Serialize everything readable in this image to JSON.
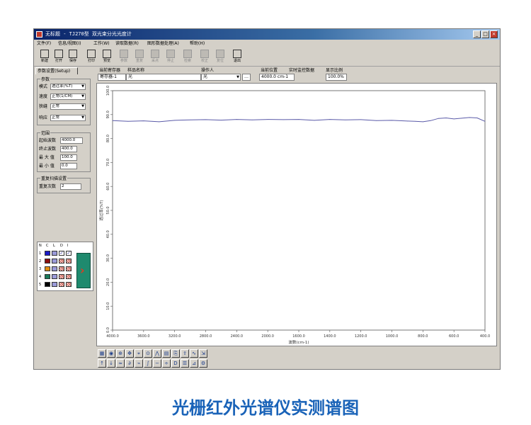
{
  "window": {
    "title": "无标题 - TJ270型 双光束分光光度计",
    "buttons": [
      "_",
      "□",
      "×"
    ]
  },
  "menu": [
    "文件(F)",
    "信息/视图(I)",
    "工作(W)",
    "读取数据(R)",
    "图形数据处理(A)",
    "帮助(H)"
  ],
  "toolbar": [
    {
      "label": "新建",
      "icon": "new-file-icon",
      "enabled": true
    },
    {
      "label": "打开",
      "icon": "open-folder-icon",
      "enabled": true
    },
    {
      "label": "保存",
      "icon": "save-disk-icon",
      "enabled": true
    },
    {
      "label": "打印",
      "icon": "print-icon",
      "enabled": true
    },
    {
      "label": "预览",
      "icon": "preview-icon",
      "enabled": true
    },
    {
      "label": "参数",
      "icon": "params-icon",
      "enabled": false
    },
    {
      "label": "重复",
      "icon": "repeat-icon",
      "enabled": false
    },
    {
      "label": "采点",
      "icon": "sample-icon",
      "enabled": false
    },
    {
      "label": "停止",
      "icon": "stop-icon",
      "enabled": false
    },
    {
      "label": "检索",
      "icon": "search-icon",
      "enabled": false
    },
    {
      "label": "校正",
      "icon": "calibrate-icon",
      "enabled": false
    },
    {
      "label": "复位",
      "icon": "reset-icon",
      "enabled": false
    },
    {
      "label": "退出",
      "icon": "exit-icon",
      "enabled": true
    }
  ],
  "left_panel": {
    "tab": "参数设置(Setup)",
    "params_group": "参数",
    "params": [
      {
        "label": "模式",
        "value": "透过率(%T)"
      },
      {
        "label": "速度",
        "value": "正常(1/CM)"
      },
      {
        "label": "狭缝",
        "value": "正常"
      },
      {
        "label": "响应",
        "value": "正常"
      }
    ],
    "range_group": "范围",
    "range": [
      {
        "label": "起始波数",
        "value": "4000.0"
      },
      {
        "label": "终止波数",
        "value": "400.0"
      },
      {
        "label": "最 大 值",
        "value": "100.0"
      },
      {
        "label": "最 小 值",
        "value": "0.0"
      }
    ],
    "repeat_group": "重复扫描设置",
    "repeat": [
      {
        "label": "重复次数",
        "value": "2"
      }
    ],
    "curve_header": [
      "N",
      "C",
      "L",
      "D",
      "I"
    ],
    "curves": [
      {
        "n": "1",
        "color": "#1a1ac8",
        "d": true,
        "i": true
      },
      {
        "n": "2",
        "color": "#8b1010",
        "d": false,
        "i": false
      },
      {
        "n": "3",
        "color": "#e08c10",
        "d": false,
        "i": false
      },
      {
        "n": "4",
        "color": "#1a7a5a",
        "d": false,
        "i": false
      },
      {
        "n": "5",
        "color": "#000000",
        "d": false,
        "i": false
      }
    ]
  },
  "info_bar": {
    "labels": [
      "当前寄存器",
      "样品名称",
      "操作人",
      "当前位置",
      "实时监控数据",
      "显示比例"
    ],
    "register": "寄存器-1",
    "sample": "光",
    "operator": "光",
    "position": "4000.0 cm-1",
    "scale": "100.0%"
  },
  "chart_data": {
    "type": "line",
    "xlabel": "波数(cm-1)",
    "ylabel": "透过率(%T)",
    "xlim": [
      4000,
      400
    ],
    "ylim": [
      0,
      100
    ],
    "x_ticks": [
      "4000.0",
      "3600.0",
      "3200.0",
      "2800.0",
      "2400.0",
      "2000.0",
      "1600.0",
      "1400.0",
      "1200.0",
      "1000.0",
      "800.0",
      "600.0",
      "400.0"
    ],
    "x_tick_values": [
      4000,
      3600,
      3200,
      2800,
      2400,
      2000,
      1600,
      1400,
      1200,
      1000,
      800,
      600,
      400
    ],
    "y_ticks": [
      "0.0",
      "10.0",
      "20.0",
      "30.0",
      "40.0",
      "50.0",
      "60.0",
      "70.0",
      "80.0",
      "90.0",
      "100.0"
    ],
    "y_tick_values": [
      0,
      10,
      20,
      30,
      40,
      50,
      60,
      70,
      80,
      90,
      100
    ],
    "series": [
      {
        "color": "#5a5aa8",
        "x": [
          4000,
          3800,
          3600,
          3400,
          3200,
          3000,
          2800,
          2600,
          2400,
          2200,
          2000,
          1800,
          1600,
          1500,
          1400,
          1300,
          1200,
          1100,
          1000,
          900,
          850,
          800,
          750,
          700,
          650,
          600,
          550,
          500,
          450,
          400
        ],
        "y": [
          87.5,
          87.2,
          87.4,
          87.0,
          87.6,
          87.8,
          87.9,
          87.7,
          88.0,
          87.8,
          88.0,
          87.9,
          88.0,
          87.6,
          88.0,
          87.8,
          87.9,
          87.5,
          87.6,
          87.3,
          87.2,
          87.0,
          87.5,
          88.4,
          88.6,
          88.2,
          88.5,
          88.8,
          88.6,
          87.2
        ]
      }
    ]
  },
  "bottom_tools": [
    "grid-icon",
    "zoom-in-icon",
    "zoom-out-icon",
    "pan-icon",
    "crosshair-icon",
    "magnify-icon",
    "peak-icon",
    "table-icon",
    "copy-icon",
    "export-icon",
    "curve-icon",
    "fit-icon",
    "up-arrow-icon",
    "down-arrow-icon",
    "smooth-icon",
    "derivative-icon",
    "baseline-icon",
    "integral-icon",
    "subtract-icon",
    "ratio-icon",
    "label-icon",
    "report-icon",
    "measure-icon",
    "settings-icon"
  ],
  "caption": "光栅红外光谱仪实测谱图"
}
